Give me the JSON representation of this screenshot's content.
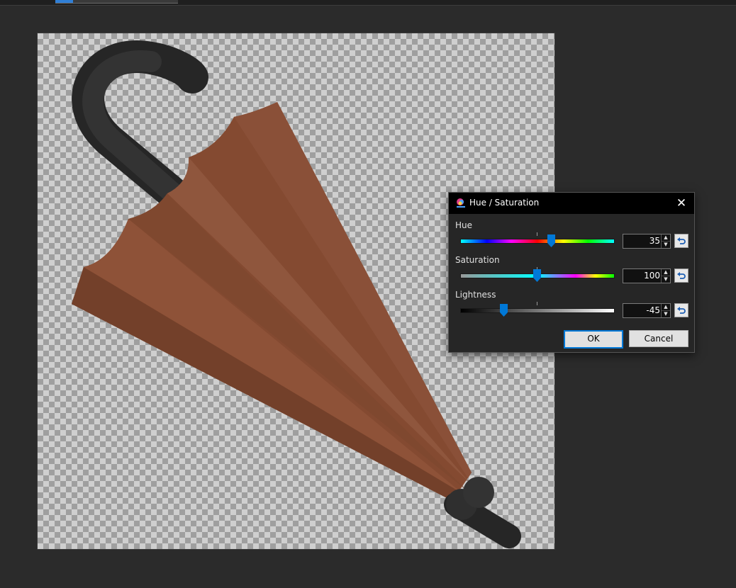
{
  "dialog": {
    "title": "Hue / Saturation",
    "close_glyph": "✕",
    "hue": {
      "label": "Hue",
      "value": "35"
    },
    "saturation": {
      "label": "Saturation",
      "value": "100"
    },
    "lightness": {
      "label": "Lightness",
      "value": "-45"
    },
    "ok_label": "OK",
    "cancel_label": "Cancel"
  },
  "icons": {
    "app": "hue-saturation-icon",
    "close": "close-icon",
    "reset": "reset-arrow-icon",
    "spin_up": "▲",
    "spin_down": "▼"
  },
  "colors": {
    "umbrella_canopy": "#8a4d33",
    "umbrella_handle": "#2f2f2f",
    "accent": "#0078d7",
    "dialog_bg": "#262626"
  }
}
